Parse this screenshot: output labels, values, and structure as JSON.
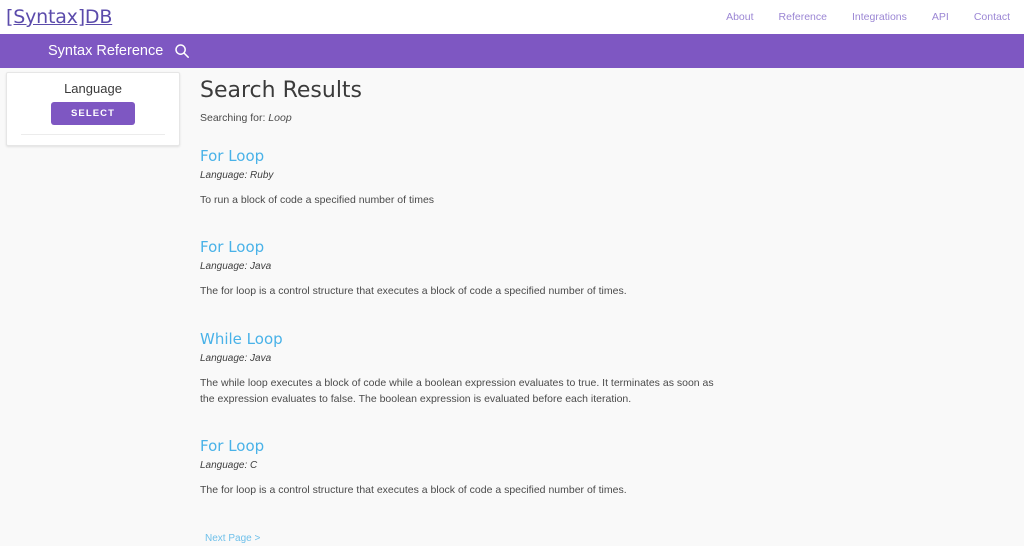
{
  "header": {
    "brand": "[Syntax]DB",
    "nav": [
      {
        "label": "About"
      },
      {
        "label": "Reference"
      },
      {
        "label": "Integrations"
      },
      {
        "label": "API"
      },
      {
        "label": "Contact"
      }
    ]
  },
  "subnav": {
    "title": "Syntax Reference",
    "search_icon": "search-icon"
  },
  "sidebar": {
    "language_card": {
      "title": "Language",
      "select_label": "SELECT"
    }
  },
  "main": {
    "page_title": "Search Results",
    "searching_prefix": "Searching for:",
    "query": "Loop",
    "results": [
      {
        "title": "For Loop",
        "language": "Language: Ruby",
        "description": "To run a block of code a specified number of times"
      },
      {
        "title": "For Loop",
        "language": "Language: Java",
        "description": "The for loop is a control structure that executes a block of code a specified number of times."
      },
      {
        "title": "While Loop",
        "language": "Language: Java",
        "description": "The while loop executes a block of code while a boolean expression evaluates to true. It terminates as soon as the expression evaluates to false. The boolean expression is evaluated before each iteration."
      },
      {
        "title": "For Loop",
        "language": "Language: C",
        "description": "The for loop is a control structure that executes a block of code a specified number of times."
      }
    ],
    "next_page_label": "Next Page >"
  },
  "colors": {
    "brand_purple": "#7e57c2",
    "logo_purple": "#5b4bab",
    "nav_link": "#9b86d4",
    "result_link": "#49b2e8",
    "page_bg": "#f9f9f9"
  }
}
